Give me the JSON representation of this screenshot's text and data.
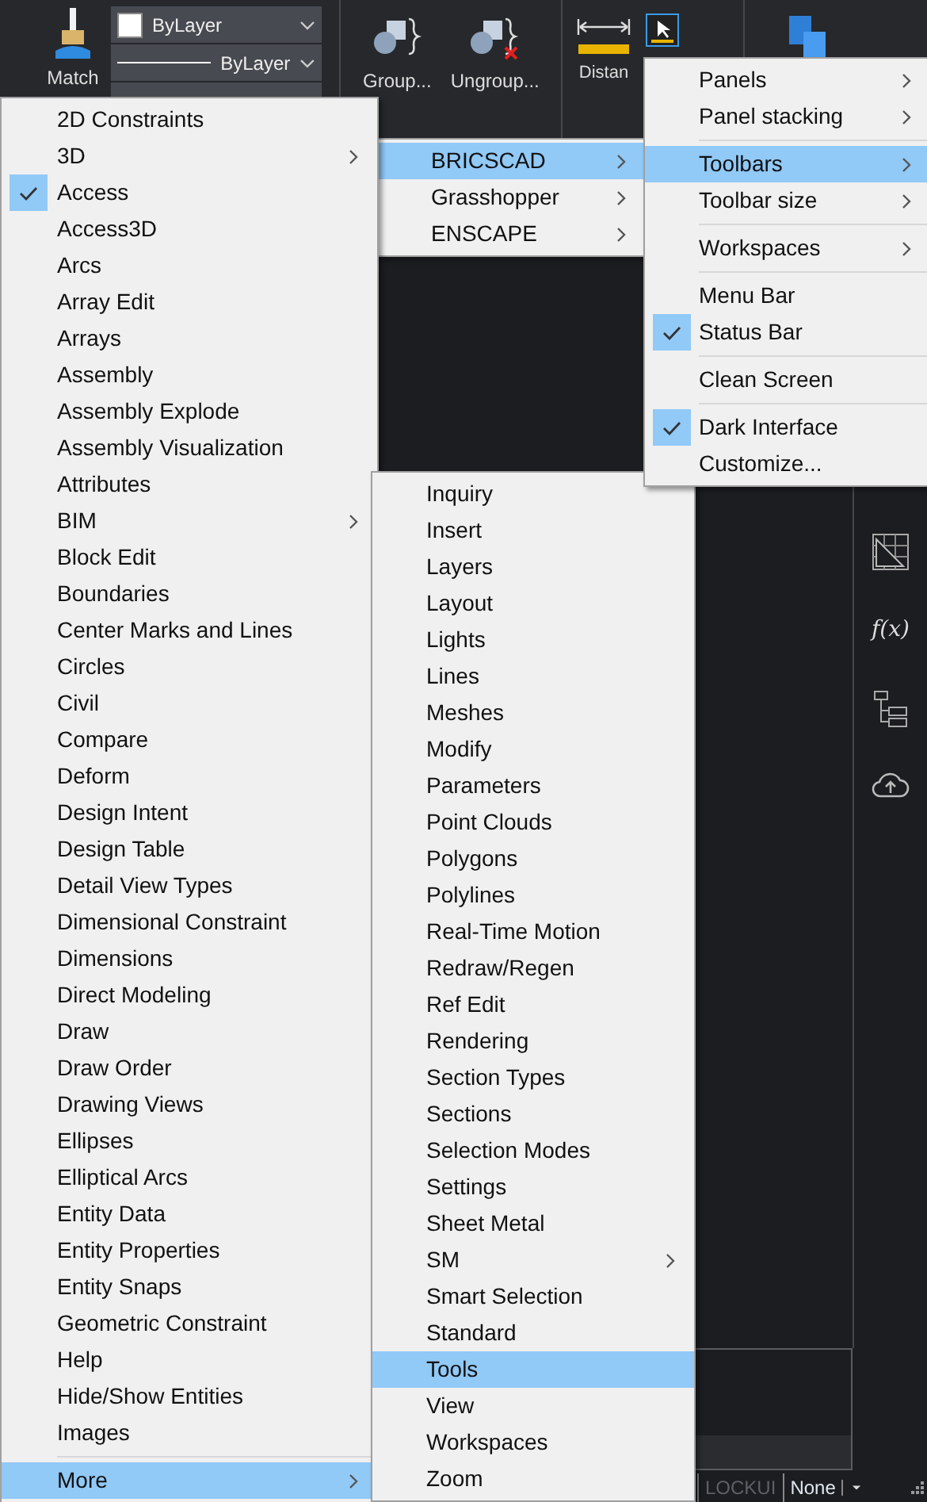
{
  "ribbon": {
    "match": {
      "label": "Match"
    },
    "dropdowns": [
      {
        "kind": "color",
        "value": "ByLayer"
      },
      {
        "kind": "linetype",
        "value": "ByLayer"
      }
    ],
    "buttons": [
      {
        "kind": "group",
        "label": "Group..."
      },
      {
        "kind": "ungroup",
        "label": "Ungroup..."
      }
    ],
    "distance": {
      "label": "Distan"
    }
  },
  "right_toolbar": {
    "function_label": "f(x)"
  },
  "main_menu": {
    "items": [
      {
        "label": "2D Constraints",
        "checked": false,
        "submenu": false,
        "selected": false
      },
      {
        "label": "3D",
        "checked": false,
        "submenu": true,
        "selected": false
      },
      {
        "label": "Access",
        "checked": true,
        "submenu": false,
        "selected": false
      },
      {
        "label": "Access3D",
        "checked": false,
        "submenu": false,
        "selected": false
      },
      {
        "label": "Arcs",
        "checked": false,
        "submenu": false,
        "selected": false
      },
      {
        "label": "Array Edit",
        "checked": false,
        "submenu": false,
        "selected": false
      },
      {
        "label": "Arrays",
        "checked": false,
        "submenu": false,
        "selected": false
      },
      {
        "label": "Assembly",
        "checked": false,
        "submenu": false,
        "selected": false
      },
      {
        "label": "Assembly Explode",
        "checked": false,
        "submenu": false,
        "selected": false
      },
      {
        "label": "Assembly Visualization",
        "checked": false,
        "submenu": false,
        "selected": false
      },
      {
        "label": "Attributes",
        "checked": false,
        "submenu": false,
        "selected": false
      },
      {
        "label": "BIM",
        "checked": false,
        "submenu": true,
        "selected": false
      },
      {
        "label": "Block Edit",
        "checked": false,
        "submenu": false,
        "selected": false
      },
      {
        "label": "Boundaries",
        "checked": false,
        "submenu": false,
        "selected": false
      },
      {
        "label": "Center Marks and Lines",
        "checked": false,
        "submenu": false,
        "selected": false
      },
      {
        "label": "Circles",
        "checked": false,
        "submenu": false,
        "selected": false
      },
      {
        "label": "Civil",
        "checked": false,
        "submenu": false,
        "selected": false
      },
      {
        "label": "Compare",
        "checked": false,
        "submenu": false,
        "selected": false
      },
      {
        "label": "Deform",
        "checked": false,
        "submenu": false,
        "selected": false
      },
      {
        "label": "Design Intent",
        "checked": false,
        "submenu": false,
        "selected": false
      },
      {
        "label": "Design Table",
        "checked": false,
        "submenu": false,
        "selected": false
      },
      {
        "label": "Detail View Types",
        "checked": false,
        "submenu": false,
        "selected": false
      },
      {
        "label": "Dimensional Constraint",
        "checked": false,
        "submenu": false,
        "selected": false
      },
      {
        "label": "Dimensions",
        "checked": false,
        "submenu": false,
        "selected": false
      },
      {
        "label": "Direct Modeling",
        "checked": false,
        "submenu": false,
        "selected": false
      },
      {
        "label": "Draw",
        "checked": false,
        "submenu": false,
        "selected": false
      },
      {
        "label": "Draw Order",
        "checked": false,
        "submenu": false,
        "selected": false
      },
      {
        "label": "Drawing Views",
        "checked": false,
        "submenu": false,
        "selected": false
      },
      {
        "label": "Ellipses",
        "checked": false,
        "submenu": false,
        "selected": false
      },
      {
        "label": "Elliptical Arcs",
        "checked": false,
        "submenu": false,
        "selected": false
      },
      {
        "label": "Entity Data",
        "checked": false,
        "submenu": false,
        "selected": false
      },
      {
        "label": "Entity Properties",
        "checked": false,
        "submenu": false,
        "selected": false
      },
      {
        "label": "Entity Snaps",
        "checked": false,
        "submenu": false,
        "selected": false
      },
      {
        "label": "Geometric Constraint",
        "checked": false,
        "submenu": false,
        "selected": false
      },
      {
        "label": "Help",
        "checked": false,
        "submenu": false,
        "selected": false
      },
      {
        "label": "Hide/Show Entities",
        "checked": false,
        "submenu": false,
        "selected": false
      },
      {
        "label": "Images",
        "checked": false,
        "submenu": false,
        "selected": false
      },
      {
        "kind": "separator"
      },
      {
        "label": "More",
        "checked": false,
        "submenu": true,
        "selected": true
      }
    ]
  },
  "source_menu": {
    "items": [
      {
        "label": "BRICSCAD",
        "checked": false,
        "submenu": true,
        "selected": true
      },
      {
        "label": "Grasshopper",
        "checked": false,
        "submenu": true,
        "selected": false
      },
      {
        "label": "ENSCAPE",
        "checked": false,
        "submenu": true,
        "selected": false
      }
    ]
  },
  "context_menu": {
    "items": [
      {
        "label": "Panels",
        "checked": false,
        "submenu": true,
        "selected": false
      },
      {
        "label": "Panel stacking",
        "checked": false,
        "submenu": true,
        "selected": false
      },
      {
        "kind": "separator"
      },
      {
        "label": "Toolbars",
        "checked": false,
        "submenu": true,
        "selected": true
      },
      {
        "label": "Toolbar size",
        "checked": false,
        "submenu": true,
        "selected": false
      },
      {
        "kind": "separator"
      },
      {
        "label": "Workspaces",
        "checked": false,
        "submenu": true,
        "selected": false
      },
      {
        "kind": "separator"
      },
      {
        "label": "Menu Bar",
        "checked": false,
        "submenu": false,
        "selected": false
      },
      {
        "label": "Status Bar",
        "checked": true,
        "submenu": false,
        "selected": false
      },
      {
        "kind": "separator"
      },
      {
        "label": "Clean Screen",
        "checked": false,
        "submenu": false,
        "selected": false
      },
      {
        "kind": "separator"
      },
      {
        "label": "Dark Interface",
        "checked": true,
        "submenu": false,
        "selected": false
      },
      {
        "label": "Customize...",
        "checked": false,
        "submenu": false,
        "selected": false
      }
    ]
  },
  "toolbars_menu": {
    "items": [
      {
        "label": "Inquiry",
        "checked": false,
        "submenu": false,
        "selected": false
      },
      {
        "label": "Insert",
        "checked": false,
        "submenu": false,
        "selected": false
      },
      {
        "label": "Layers",
        "checked": false,
        "submenu": false,
        "selected": false
      },
      {
        "label": "Layout",
        "checked": false,
        "submenu": false,
        "selected": false
      },
      {
        "label": "Lights",
        "checked": false,
        "submenu": false,
        "selected": false
      },
      {
        "label": "Lines",
        "checked": false,
        "submenu": false,
        "selected": false
      },
      {
        "label": "Meshes",
        "checked": false,
        "submenu": false,
        "selected": false
      },
      {
        "label": "Modify",
        "checked": false,
        "submenu": false,
        "selected": false
      },
      {
        "label": "Parameters",
        "checked": false,
        "submenu": false,
        "selected": false
      },
      {
        "label": "Point Clouds",
        "checked": false,
        "submenu": false,
        "selected": false
      },
      {
        "label": "Polygons",
        "checked": false,
        "submenu": false,
        "selected": false
      },
      {
        "label": "Polylines",
        "checked": false,
        "submenu": false,
        "selected": false
      },
      {
        "label": "Real-Time Motion",
        "checked": false,
        "submenu": false,
        "selected": false
      },
      {
        "label": "Redraw/Regen",
        "checked": false,
        "submenu": false,
        "selected": false
      },
      {
        "label": "Ref Edit",
        "checked": false,
        "submenu": false,
        "selected": false
      },
      {
        "label": "Rendering",
        "checked": false,
        "submenu": false,
        "selected": false
      },
      {
        "label": "Section Types",
        "checked": false,
        "submenu": false,
        "selected": false
      },
      {
        "label": "Sections",
        "checked": false,
        "submenu": false,
        "selected": false
      },
      {
        "label": "Selection Modes",
        "checked": false,
        "submenu": false,
        "selected": false
      },
      {
        "label": "Settings",
        "checked": false,
        "submenu": false,
        "selected": false
      },
      {
        "label": "Sheet Metal",
        "checked": false,
        "submenu": false,
        "selected": false
      },
      {
        "label": "SM",
        "checked": false,
        "submenu": true,
        "selected": false
      },
      {
        "label": "Smart Selection",
        "checked": false,
        "submenu": false,
        "selected": false
      },
      {
        "label": "Standard",
        "checked": false,
        "submenu": false,
        "selected": false
      },
      {
        "label": "Tools",
        "checked": false,
        "submenu": false,
        "selected": true
      },
      {
        "label": "View",
        "checked": false,
        "submenu": false,
        "selected": false
      },
      {
        "label": "Workspaces",
        "checked": false,
        "submenu": false,
        "selected": false
      },
      {
        "label": "Zoom",
        "checked": false,
        "submenu": false,
        "selected": false
      }
    ]
  },
  "status_bar": {
    "items": [
      {
        "label": "LOCKUI",
        "disabled": true
      },
      {
        "label": "None",
        "disabled": false
      }
    ]
  }
}
